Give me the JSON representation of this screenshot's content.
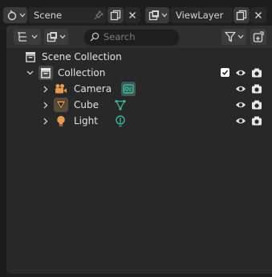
{
  "top_bar": {
    "scene_name": "Scene",
    "view_layer_name": "ViewLayer"
  },
  "outliner_header": {
    "search_placeholder": "Search"
  },
  "tree": {
    "scene_collection": "Scene Collection",
    "collection": "Collection",
    "items": [
      {
        "label": "Camera",
        "icon": "camera-icon",
        "data_icon": "camera-data-icon"
      },
      {
        "label": "Cube",
        "icon": "mesh-icon",
        "data_icon": "vertex-data-icon"
      },
      {
        "label": "Light",
        "icon": "light-icon",
        "data_icon": "light-data-icon"
      }
    ]
  },
  "colors": {
    "camera_accent": "#3bb79a",
    "object_orange": "#e69a4f",
    "checkbox": "#ffffff"
  }
}
